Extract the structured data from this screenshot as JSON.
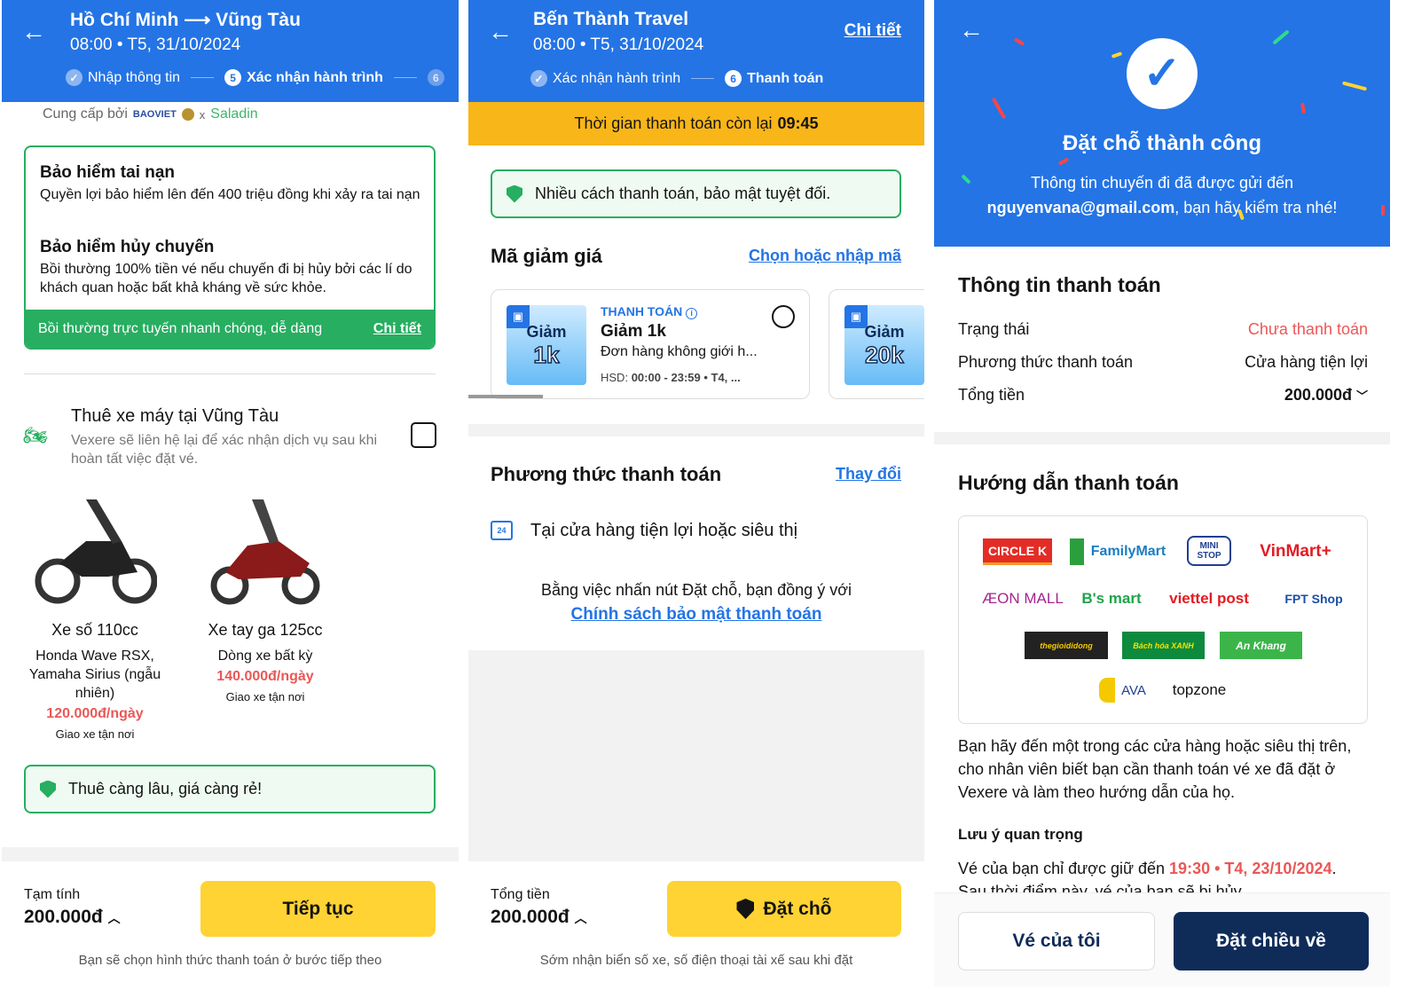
{
  "screen1": {
    "header": {
      "title": "Hồ Chí Minh ⟶ Vũng Tàu",
      "subtitle": "08:00 • T5, 31/10/2024",
      "steps": [
        {
          "num": "✓",
          "label": "Nhập thông tin"
        },
        {
          "num": "5",
          "label": "Xác nhận hành trình"
        },
        {
          "num": "6",
          "label": ""
        }
      ]
    },
    "provider": {
      "label": "Cung cấp bởi",
      "brand1": "BAOVIET",
      "sep": "x",
      "brand2": "Saladin"
    },
    "insurance": [
      {
        "title": "Bảo hiểm tai nạn",
        "desc": "Quyền lợi bảo hiểm lên đến 400 triệu đồng khi xảy ra tai nạn"
      },
      {
        "title": "Bảo hiểm hủy chuyến",
        "desc": "Bồi thường 100% tiền vé nếu chuyến đi bị hủy bởi các lí do khách quan hoặc bất khả kháng về sức khỏe."
      }
    ],
    "insurance_footer": {
      "text": "Bồi thường trực tuyến nhanh chóng, dễ dàng",
      "link": "Chi tiết"
    },
    "rental": {
      "title": "Thuê xe máy tại Vũng Tàu",
      "desc": "Vexere sẽ liên hệ lại để xác nhận dịch vụ sau khi hoàn tất việc đặt vé.",
      "checked": false
    },
    "bikes": [
      {
        "name": "Xe số 110cc",
        "models": "Honda Wave RSX, Yamaha Sirius (ngẫu nhiên)",
        "price": "120.000đ/ngày",
        "delivery": "Giao xe tận nơi",
        "color": "#222"
      },
      {
        "name": "Xe tay ga 125cc",
        "models": "Dòng xe bất kỳ",
        "price": "140.000đ/ngày",
        "delivery": "Giao xe tận nơi",
        "color": "#8B1A1A"
      }
    ],
    "promo_note": "Thuê càng lâu, giá càng rẻ!",
    "footer": {
      "label": "Tạm tính",
      "total": "200.000đ",
      "button": "Tiếp tục",
      "hint": "Bạn sẽ chọn hình thức thanh toán ở bước tiếp theo"
    }
  },
  "screen2": {
    "header": {
      "title": "Bến Thành Travel",
      "subtitle": "08:00 • T5, 31/10/2024",
      "link": "Chi tiết",
      "steps": [
        {
          "num": "✓",
          "label": "Xác nhận hành trình"
        },
        {
          "num": "6",
          "label": "Thanh toán"
        }
      ]
    },
    "timer": {
      "label": "Thời gian thanh toán còn lại",
      "value": "09:45"
    },
    "secure_note": "Nhiều cách thanh toán, bảo mật tuyệt đối.",
    "discount": {
      "title": "Mã giảm giá",
      "link": "Chọn hoặc nhập mã",
      "vouchers": [
        {
          "img_top": "Giảm",
          "img_value": "1k",
          "tag": "THANH TOÁN",
          "title": "Giảm 1k",
          "desc": "Đơn hàng không giới h...",
          "hsd_label": "HSD:",
          "hsd": "00:00 - 23:59 • T4, ..."
        },
        {
          "img_top": "Giảm",
          "img_value": "20k"
        }
      ]
    },
    "payment": {
      "title": "Phương thức thanh toán",
      "link": "Thay đổi",
      "method": "Tại cửa hàng tiện lợi hoặc siêu thị",
      "agree": "Bằng việc nhấn nút Đặt chỗ, bạn đồng ý với",
      "policy": "Chính sách bảo mật thanh toán"
    },
    "footer": {
      "label": "Tổng tiền",
      "total": "200.000đ",
      "button": "Đặt chỗ",
      "hint": "Sớm nhận biển số xe, số điện thoại tài xế sau khi đặt"
    }
  },
  "screen3": {
    "header": {
      "title": "Đặt chỗ thành công",
      "line1": "Thông tin chuyến đi đã được gửi đến",
      "email": "nguyenvana@gmail.com",
      "line2": ", bạn hãy kiểm tra nhé!"
    },
    "info": {
      "title": "Thông tin thanh toán",
      "rows": [
        {
          "label": "Trạng thái",
          "value": "Chưa thanh toán"
        },
        {
          "label": "Phương thức thanh toán",
          "value": "Cửa hàng tiện lợi"
        },
        {
          "label": "Tổng tiền",
          "value": "200.000đ"
        }
      ]
    },
    "guide": {
      "title": "Hướng dẫn thanh toán",
      "stores": [
        "CIRCLE K",
        "FamilyMart",
        "MINI STOP",
        "VinMart+",
        "ÆON MALL",
        "B's mart",
        "viettel post",
        "FPT Shop",
        "thegioididong",
        "Bách hóa XANH",
        "An Khang",
        "AVA",
        "topzone"
      ],
      "text": "Bạn hãy đến một trong các cửa hàng hoặc siêu thị trên, cho nhân viên biết bạn cần thanh toán vé xe đã đặt ở Vexere và làm theo hướng dẫn của họ."
    },
    "notice": {
      "title": "Lưu ý quan trọng",
      "prefix": "Vé của bạn chỉ được giữ đến ",
      "deadline": "19:30 • T4, 23/10/2024",
      "suffix": ".",
      "line2": "Sau thời điểm này, vé của bạn sẽ bị hủy."
    },
    "footer": {
      "my_tickets": "Vé của tôi",
      "return_trip": "Đặt chiều về"
    }
  },
  "colors": {
    "primary": "#2474E5",
    "accent_yellow": "#FFD333",
    "success": "#27AE60",
    "danger": "#EB5757",
    "navy": "#0F2C59"
  }
}
